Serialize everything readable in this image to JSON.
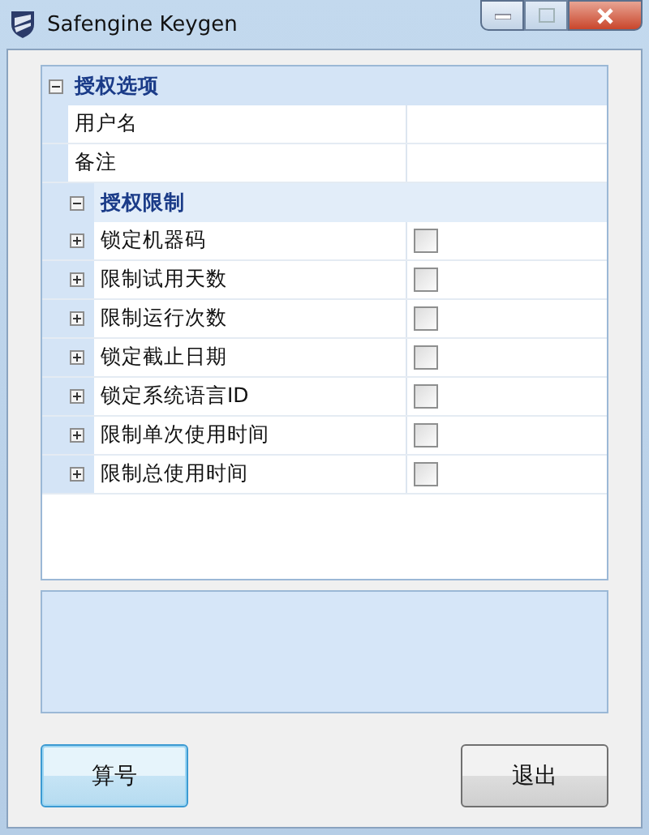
{
  "window": {
    "title": "Safengine Keygen"
  },
  "sections": [
    {
      "label": "授权选项",
      "expanded": true,
      "items": [
        {
          "kind": "text",
          "label": "用户名"
        },
        {
          "kind": "text",
          "label": "备注"
        },
        {
          "kind": "group",
          "label": "授权限制",
          "expanded": true,
          "children": [
            {
              "kind": "checkbox",
              "label": "锁定机器码",
              "expanded": false,
              "checked": false
            },
            {
              "kind": "checkbox",
              "label": "限制试用天数",
              "expanded": false,
              "checked": false
            },
            {
              "kind": "checkbox",
              "label": "限制运行次数",
              "expanded": false,
              "checked": false
            },
            {
              "kind": "checkbox",
              "label": "锁定截止日期",
              "expanded": false,
              "checked": false
            },
            {
              "kind": "checkbox",
              "label": "锁定系统语言ID",
              "expanded": false,
              "checked": false
            },
            {
              "kind": "checkbox",
              "label": "限制单次使用时间",
              "expanded": false,
              "checked": false
            },
            {
              "kind": "checkbox",
              "label": "限制总使用时间",
              "expanded": false,
              "checked": false
            }
          ]
        }
      ]
    }
  ],
  "buttons": [
    {
      "label": "算号",
      "focused": true
    },
    {
      "label": "退出",
      "focused": false
    }
  ]
}
